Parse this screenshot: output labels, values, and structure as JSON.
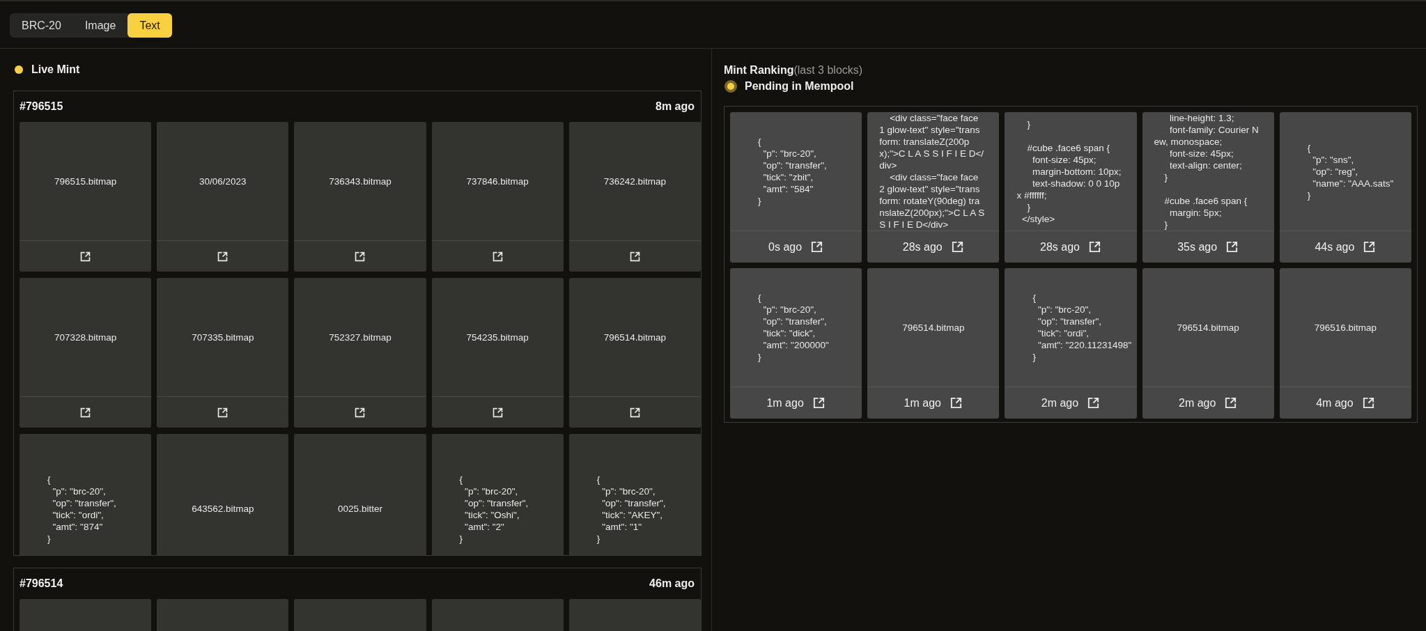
{
  "tabs": [
    {
      "label": "BRC-20",
      "selected": false
    },
    {
      "label": "Image",
      "selected": false
    },
    {
      "label": "Text",
      "selected": true
    }
  ],
  "live_mint": {
    "title": "Live Mint",
    "blocks": [
      {
        "number": "#796515",
        "time": "8m ago",
        "cards": [
          {
            "kind": "name",
            "content": "796515.bitmap",
            "open_link": true
          },
          {
            "kind": "name",
            "content": "30/06/2023",
            "open_link": true
          },
          {
            "kind": "name",
            "content": "736343.bitmap",
            "open_link": true
          },
          {
            "kind": "name",
            "content": "737846.bitmap",
            "open_link": true
          },
          {
            "kind": "name",
            "content": "736242.bitmap",
            "open_link": true
          },
          {
            "kind": "name",
            "content": "707328.bitmap",
            "open_link": true
          },
          {
            "kind": "name",
            "content": "707335.bitmap",
            "open_link": true
          },
          {
            "kind": "name",
            "content": "752327.bitmap",
            "open_link": true
          },
          {
            "kind": "name",
            "content": "754235.bitmap",
            "open_link": true
          },
          {
            "kind": "name",
            "content": "796514.bitmap",
            "open_link": true
          },
          {
            "kind": "json",
            "content": "{\n  \"p\": \"brc-20\",\n  \"op\": \"transfer\",\n  \"tick\": \"ordi\",\n  \"amt\": \"874\"\n}",
            "open_link": false
          },
          {
            "kind": "name",
            "content": "643562.bitmap",
            "open_link": false
          },
          {
            "kind": "name",
            "content": "0025.bitter",
            "open_link": false
          },
          {
            "kind": "json",
            "content": "{\n  \"p\": \"brc-20\",\n  \"op\": \"transfer\",\n  \"tick\": \"Oshi\",\n  \"amt\": \"2\"\n}",
            "open_link": false
          },
          {
            "kind": "json",
            "content": "{\n  \"p\": \"brc-20\",\n  \"op\": \"transfer\",\n  \"tick\": \"AKEY\",\n  \"amt\": \"1\"\n}",
            "open_link": false
          }
        ]
      },
      {
        "number": "#796514",
        "time": "46m ago",
        "cards": [
          {
            "kind": "blank"
          },
          {
            "kind": "blank"
          },
          {
            "kind": "blank"
          },
          {
            "kind": "blank"
          },
          {
            "kind": "blank"
          }
        ]
      }
    ]
  },
  "mint_ranking": {
    "title": "Mint Ranking",
    "subtitle": "(last 3 blocks)",
    "pending": "Pending in Mempool",
    "cards": [
      {
        "kind": "json",
        "content": "{\n  \"p\": \"brc-20\",\n  \"op\": \"transfer\",\n  \"tick\": \"zbit\",\n  \"amt\": \"584\"\n}",
        "time": "0s ago"
      },
      {
        "kind": "code",
        "content": "    <div class=\"face face\n1 glow-text\" style=\"trans\nform: translateZ(200p\nx);\">C L A S S I F I E D</\ndiv>\n    <div class=\"face face\n2 glow-text\" style=\"trans\nform: rotateY(90deg) tra\nnslateZ(200px);\">C L A S\nS I F I E D</div>",
        "time": "28s ago"
      },
      {
        "kind": "code",
        "content": "    }\n\n    #cube .face6 span {\n      font-size: 45px;\n      margin-bottom: 10px;\n      text-shadow: 0 0 10p\nx #ffffff;\n    }\n  </style>",
        "time": "28s ago"
      },
      {
        "kind": "code",
        "content": "      line-height: 1.3;\n      font-family: Courier N\new, monospace;\n      font-size: 45px;\n      text-align: center;\n    }\n\n    #cube .face6 span {\n      margin: 5px;\n    }",
        "time": "35s ago"
      },
      {
        "kind": "json",
        "content": "{\n  \"p\": \"sns\",\n  \"op\": \"reg\",\n  \"name\": \"AAA.sats\"\n}",
        "time": "44s ago"
      },
      {
        "kind": "json",
        "content": "{\n  \"p\": \"brc-20\",\n  \"op\": \"transfer\",\n  \"tick\": \"dick\",\n  \"amt\": \"200000\"\n}",
        "time": "1m ago"
      },
      {
        "kind": "name",
        "content": "796514.bitmap",
        "time": "1m ago"
      },
      {
        "kind": "json",
        "content": "{\n  \"p\": \"brc-20\",\n  \"op\": \"transfer\",\n  \"tick\": \"ordi\",\n  \"amt\": \"220.11231498\"\n}",
        "time": "2m ago"
      },
      {
        "kind": "name",
        "content": "796514.bitmap",
        "time": "2m ago"
      },
      {
        "kind": "name",
        "content": "796516.bitmap",
        "time": "4m ago"
      }
    ]
  }
}
